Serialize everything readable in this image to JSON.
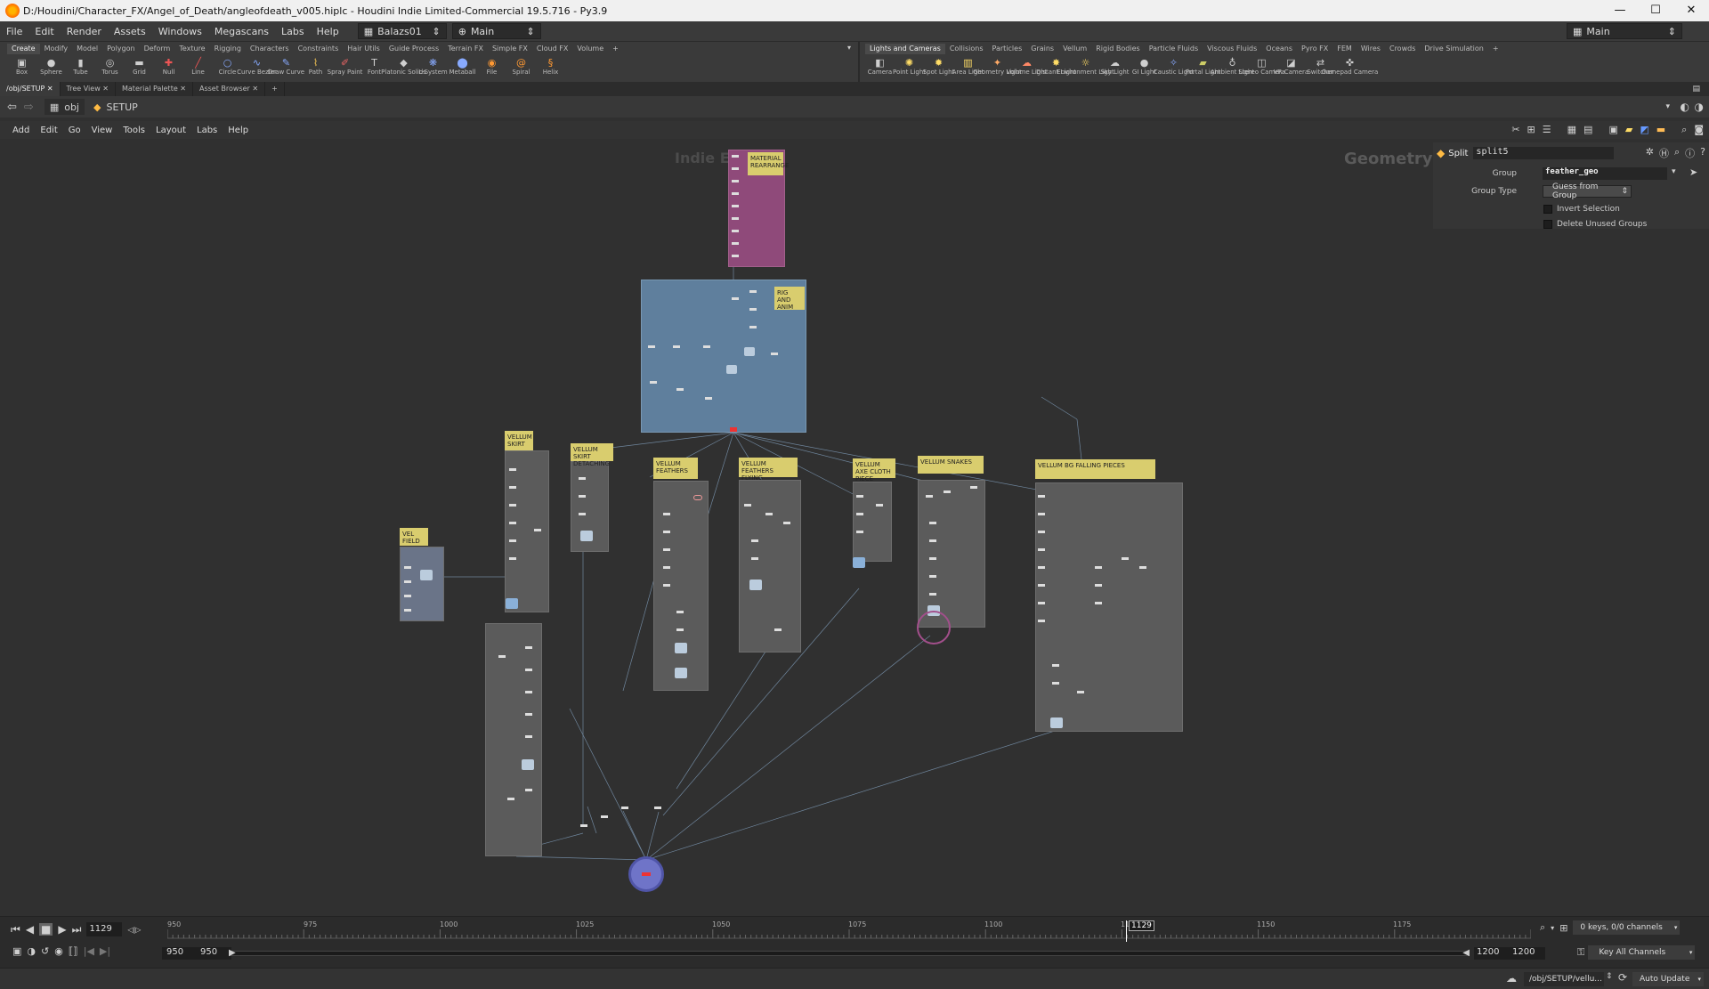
{
  "window": {
    "title": "D:/Houdini/Character_FX/Angel_of_Death/angleofdeath_v005.hiplc - Houdini Indie Limited-Commercial 19.5.716 - Py3.9",
    "minimize": "—",
    "maximize": "☐",
    "close": "✕"
  },
  "menu": {
    "items": [
      "File",
      "Edit",
      "Render",
      "Assets",
      "Windows",
      "Megascans",
      "Labs",
      "Help"
    ],
    "desktop": "Balazs01",
    "context": "Main",
    "right_desktop": "Main"
  },
  "shelf_left": {
    "tabs": [
      "Create",
      "Modify",
      "Model",
      "Polygon",
      "Deform",
      "Texture",
      "Rigging",
      "Characters",
      "Constraints",
      "Hair Utils",
      "Guide Process",
      "Terrain FX",
      "Simple FX",
      "Cloud FX",
      "Volume"
    ],
    "tools": [
      "Box",
      "Sphere",
      "Tube",
      "Torus",
      "Grid",
      "Null",
      "Line",
      "Circle",
      "Curve Bezier",
      "Draw Curve",
      "Path",
      "Spray Paint",
      "Font",
      "Platonic Solids",
      "L-System",
      "Metaball",
      "File",
      "Spiral",
      "Helix"
    ]
  },
  "shelf_right": {
    "tabs": [
      "Lights and Cameras",
      "Collisions",
      "Particles",
      "Grains",
      "Vellum",
      "Rigid Bodies",
      "Particle Fluids",
      "Viscous Fluids",
      "Oceans",
      "Pyro FX",
      "FEM",
      "Wires",
      "Crowds",
      "Drive Simulation"
    ],
    "tools": [
      "Camera",
      "Point Light",
      "Spot Light",
      "Area Light",
      "Geometry Light",
      "Volume Light",
      "Distant Light",
      "Environment Light",
      "Sky Light",
      "GI Light",
      "Caustic Light",
      "Portal Light",
      "Ambient Light",
      "Stereo Camera",
      "VR Camera",
      "Switcher",
      "Gamepad Camera"
    ]
  },
  "panel_tabs": [
    "/obj/SETUP",
    "Tree View",
    "Material Palette",
    "Asset Browser"
  ],
  "path": {
    "obj": "obj",
    "node": "SETUP"
  },
  "network_menu": [
    "Add",
    "Edit",
    "Go",
    "View",
    "Tools",
    "Layout",
    "Labs",
    "Help"
  ],
  "network": {
    "watermark_left": "Indie Edi",
    "watermark_right": "Geometry",
    "sticky_notes": {
      "material": "MATERIAL REARRANGE",
      "rig": "RIG AND ANIM",
      "vellum_skirt": "VELLUM SKIRT",
      "skirt_detaching": "VELLUM SKIRT DETACHING",
      "feathers": "VELLUM FEATHERS",
      "feathers_flying": "VELLUM FEATHERS FLYING",
      "axe": "VELLUM AXE CLOTH PIECE",
      "snakes": "VELLUM SNAKES",
      "bg_pieces": "VELLUM BG FALLING PIECES",
      "vel_field": "VEL FIELD"
    }
  },
  "params": {
    "node_type": "Split",
    "node_name": "split5",
    "group_label": "Group",
    "group_value": "feather_geo",
    "group_type_label": "Group Type",
    "group_type_value": "Guess from Group",
    "invert_label": "Invert Selection",
    "delete_label": "Delete Unused Groups"
  },
  "timeline": {
    "current_frame": "1129",
    "marker": "1129",
    "ticks": [
      "950",
      "975",
      "1000",
      "1025",
      "1050",
      "1075",
      "1100",
      "1125",
      "1150",
      "1175"
    ],
    "range_start": "950",
    "range_start2": "950",
    "range_end": "1200",
    "range_end2": "1200",
    "keys_info": "0 keys, 0/0 channels",
    "key_all": "Key All Channels"
  },
  "status": {
    "path": "/obj/SETUP/vellu...",
    "update": "Auto Update"
  }
}
